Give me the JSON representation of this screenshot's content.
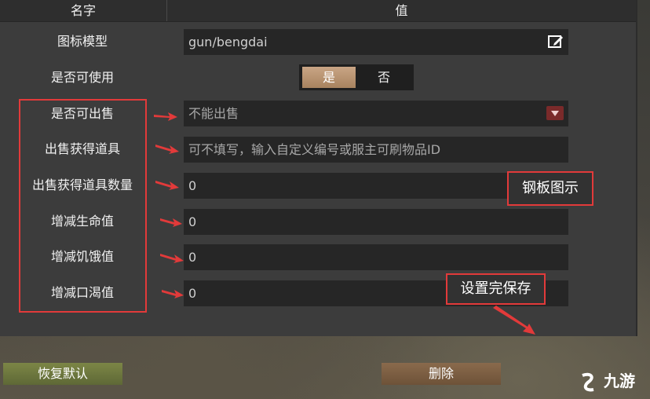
{
  "header": {
    "col_name": "名字",
    "col_value": "值"
  },
  "rows": [
    {
      "label": "图标模型",
      "value": "gun/bengdai"
    },
    {
      "label": "是否可使用",
      "toggle_yes": "是",
      "toggle_no": "否",
      "selected": "是"
    },
    {
      "label": "是否可出售",
      "value": "不能出售"
    },
    {
      "label": "出售获得道具",
      "placeholder": "可不填写，输入自定义编号或服主可刷物品ID"
    },
    {
      "label": "出售获得道具数量",
      "value": "0"
    },
    {
      "label": "增减生命值",
      "value": "0"
    },
    {
      "label": "增减饥饿值",
      "value": "0"
    },
    {
      "label": "增减口渴值",
      "value": "0"
    }
  ],
  "annotations": {
    "steel_plate": "钢板图示",
    "save_hint": "设置完保存"
  },
  "buttons": {
    "reset": "恢复默认",
    "delete": "删除"
  },
  "watermark": {
    "text": "九游"
  },
  "colors": {
    "highlight_red": "#e23a3a",
    "toggle_active": "#c9a585",
    "reset_btn": "#7c8646",
    "delete_btn": "#8a6a4c"
  }
}
